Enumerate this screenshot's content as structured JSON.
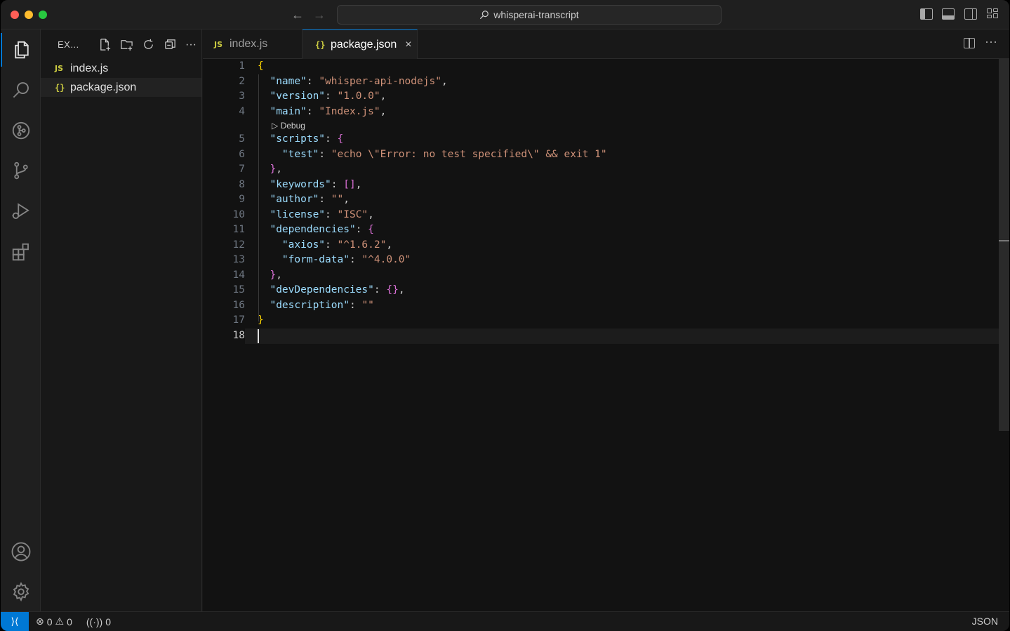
{
  "titlebar": {
    "search_text": "whisperai-transcript",
    "colors": {
      "close": "#ff5f57",
      "minimize": "#febc2e",
      "maximize": "#28c840"
    }
  },
  "sidebar": {
    "title": "EX...",
    "files": [
      {
        "name": "index.js",
        "icon": "JS"
      },
      {
        "name": "package.json",
        "icon": "{}"
      }
    ]
  },
  "tabs": [
    {
      "label": "index.js",
      "icon": "JS"
    },
    {
      "label": "package.json",
      "icon": "{}",
      "close": "×"
    }
  ],
  "editor": {
    "codelens": "Debug",
    "lines": [
      {
        "n": "1",
        "kind": "open",
        "text": "{"
      },
      {
        "n": "2",
        "kind": "kv",
        "key": "\"name\"",
        "val": "\"whisper-api-nodejs\"",
        "end": ","
      },
      {
        "n": "3",
        "kind": "kv",
        "key": "\"version\"",
        "val": "\"1.0.0\"",
        "end": ","
      },
      {
        "n": "4",
        "kind": "kv",
        "key": "\"main\"",
        "val": "\"Index.js\"",
        "end": ","
      },
      {
        "n": "5",
        "kind": "kobj",
        "key": "\"scripts\"",
        "brace": "{"
      },
      {
        "n": "6",
        "kind": "kv2",
        "key": "\"test\"",
        "val": "\"echo \\\"Error: no test specified\\\" && exit 1\"",
        "end": ""
      },
      {
        "n": "7",
        "kind": "close2",
        "text": "}",
        "end": ","
      },
      {
        "n": "8",
        "kind": "karr",
        "key": "\"keywords\"",
        "brace": "[]",
        "end": ","
      },
      {
        "n": "9",
        "kind": "kv",
        "key": "\"author\"",
        "val": "\"\"",
        "end": ","
      },
      {
        "n": "10",
        "kind": "kv",
        "key": "\"license\"",
        "val": "\"ISC\"",
        "end": ","
      },
      {
        "n": "11",
        "kind": "kobj",
        "key": "\"dependencies\"",
        "brace": "{"
      },
      {
        "n": "12",
        "kind": "kv2",
        "key": "\"axios\"",
        "val": "\"^1.6.2\"",
        "end": ","
      },
      {
        "n": "13",
        "kind": "kv2",
        "key": "\"form-data\"",
        "val": "\"^4.0.0\"",
        "end": ""
      },
      {
        "n": "14",
        "kind": "close2",
        "text": "}",
        "end": ","
      },
      {
        "n": "15",
        "kind": "karr",
        "key": "\"devDependencies\"",
        "brace": "{}",
        "end": ","
      },
      {
        "n": "16",
        "kind": "kv",
        "key": "\"description\"",
        "val": "\"\"",
        "end": ""
      },
      {
        "n": "17",
        "kind": "close",
        "text": "}"
      },
      {
        "n": "18",
        "kind": "empty",
        "text": ""
      }
    ]
  },
  "statusbar": {
    "errors": "0",
    "warnings": "0",
    "ports": "0",
    "language": "JSON",
    "accent": "#0078d4"
  }
}
